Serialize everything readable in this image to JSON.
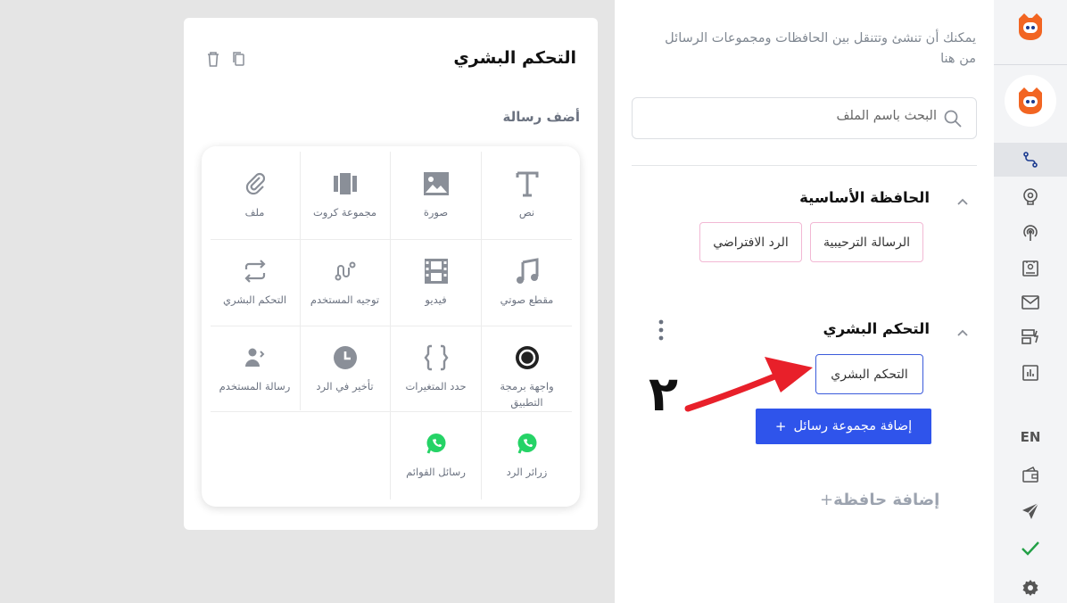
{
  "card": {
    "title": "التحكم البشري",
    "add_message_label": "أضف رسالة",
    "tiles": [
      {
        "label": "نص",
        "icon": "text-icon"
      },
      {
        "label": "صورة",
        "icon": "image-icon"
      },
      {
        "label": "مجموعة كروت",
        "icon": "cards-icon"
      },
      {
        "label": "ملف",
        "icon": "paperclip-icon"
      },
      {
        "label": "مقطع صوتي",
        "icon": "music-icon"
      },
      {
        "label": "فيديو",
        "icon": "film-icon"
      },
      {
        "label": "توجيه المستخدم",
        "icon": "route-icon"
      },
      {
        "label": "التحكم البشري",
        "icon": "repeat-icon"
      },
      {
        "label": "واجهة برمجة التطبيق",
        "icon": "api-icon"
      },
      {
        "label": "حدد المتغيرات",
        "icon": "braces-icon"
      },
      {
        "label": "تأخير في الرد",
        "icon": "clock-icon"
      },
      {
        "label": "رسالة المستخدم",
        "icon": "user-message-icon"
      },
      {
        "label": "زرائر الرد",
        "icon": "whatsapp-icon"
      },
      {
        "label": "رسائل القوائم",
        "icon": "whatsapp-icon"
      }
    ]
  },
  "panel": {
    "intro": "يمكنك أن تنشئ وتتنقل بين الحافظات ومجموعات الرسائل من هنا",
    "search_placeholder": "البحث باسم الملف",
    "sections": [
      {
        "title": "الحافظة الأساسية",
        "chips": [
          "الرسالة الترحيبية",
          "الرد الافتراضي"
        ]
      },
      {
        "title": "التحكم البشري",
        "chips": [
          "التحكم البشري"
        ]
      }
    ],
    "add_group_label": "إضافة مجموعة رسائل",
    "add_store_label": "إضافة حافظة",
    "annotation_number": "٢"
  },
  "rail": {
    "language": "EN"
  },
  "colors": {
    "primary": "#2f54eb",
    "logo_orange": "#f26522",
    "logo_blue": "#1a3a8f",
    "whatsapp": "#25d366",
    "arrow_red": "#e8202a",
    "check_green": "#22a046"
  }
}
